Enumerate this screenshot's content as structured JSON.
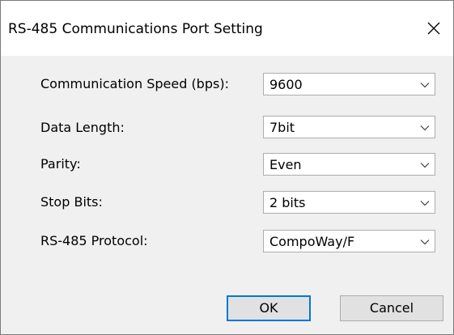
{
  "window": {
    "title": "RS-485 Communications Port Setting"
  },
  "fields": [
    {
      "label": "Communication Speed (bps):",
      "value": "9600"
    },
    {
      "label": "Data Length:",
      "value": "7bit"
    },
    {
      "label": "Parity:",
      "value": "Even"
    },
    {
      "label": "Stop Bits:",
      "value": "2 bits"
    },
    {
      "label": "RS-485 Protocol:",
      "value": "CompoWay/F"
    }
  ],
  "buttons": {
    "ok_label": "OK",
    "cancel_label": "Cancel"
  },
  "icons": {
    "close": "close-icon",
    "dropdown": "chevron-down-icon"
  },
  "colors": {
    "default_button_border": "#0078d7"
  }
}
